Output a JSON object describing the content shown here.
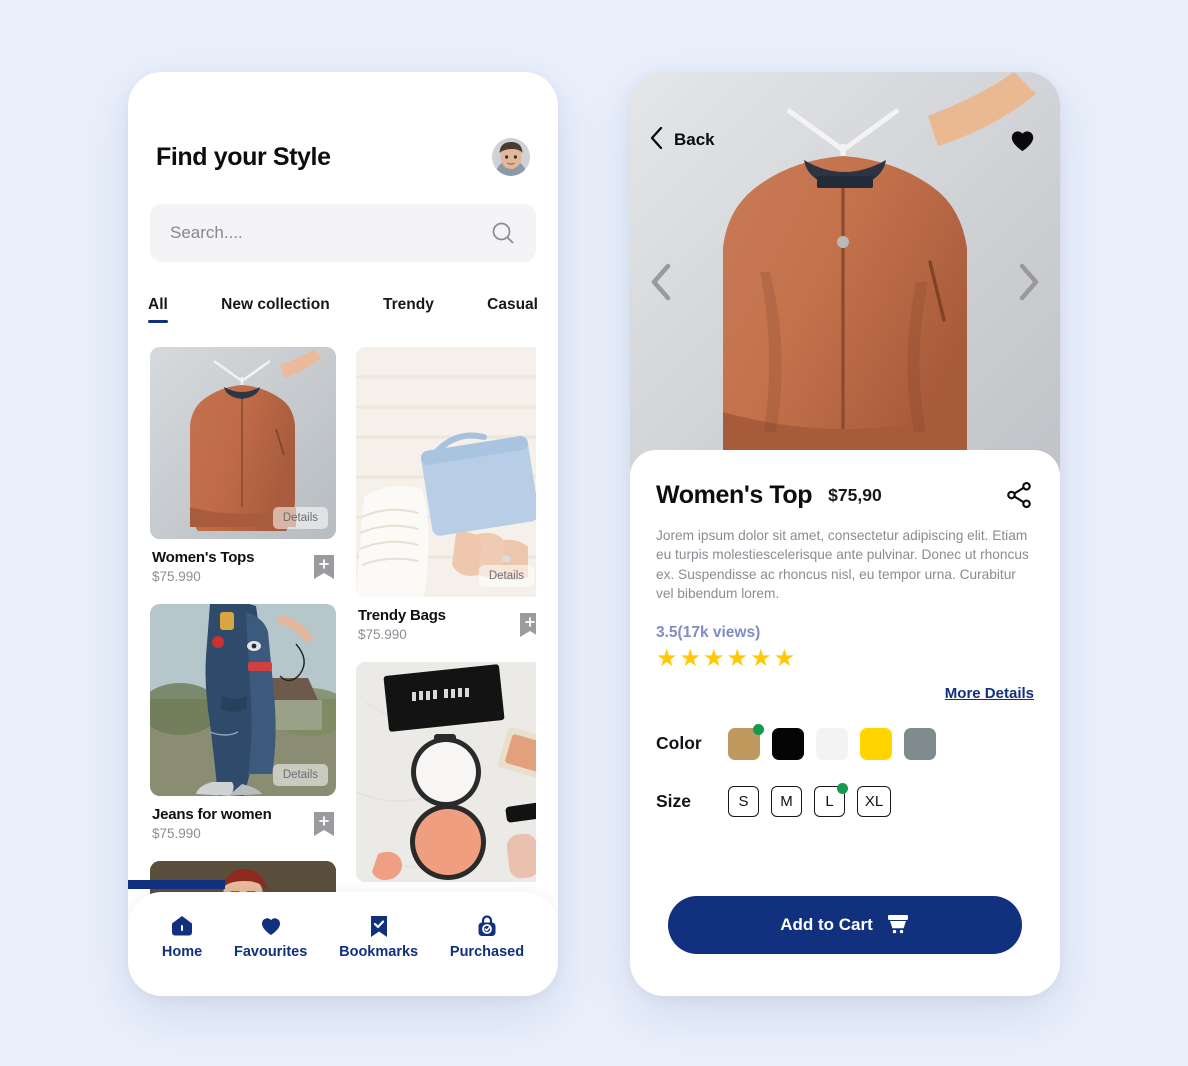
{
  "page": {
    "background_color": "#e9effb"
  },
  "browse_screen": {
    "title": "Find your Style",
    "avatar_name": "user-avatar",
    "search": {
      "placeholder": "Search....",
      "value": "",
      "icon": "search-icon"
    },
    "tabs": [
      {
        "label": "All",
        "active": true
      },
      {
        "label": "New collection",
        "active": false
      },
      {
        "label": "Trendy",
        "active": false
      },
      {
        "label": "Casual",
        "active": false
      }
    ],
    "details_badge_label": "Details",
    "products": [
      {
        "name": "Women's Tops",
        "price": "$75.990",
        "image": "orange-bomber-jacket-on-hanger",
        "column": "left",
        "badge": "Details"
      },
      {
        "name": "Trendy Bags",
        "price": "$75.990",
        "image": "light-blue-handbag-held-in-hand",
        "column": "right",
        "badge": "Details"
      },
      {
        "name": "Jeans for women",
        "price": "$75.990",
        "image": "woman-wearing-ripped-blue-jeans",
        "column": "left",
        "badge": "Details"
      },
      {
        "name": "",
        "price": "",
        "image": "makeup-flatlay-on-marble",
        "column": "right",
        "badge": ""
      },
      {
        "name": "",
        "price": "",
        "image": "smiling-woman-in-red-top",
        "column": "left",
        "badge": ""
      }
    ],
    "bottom_nav": [
      {
        "label": "Home",
        "icon": "home-icon",
        "active": true
      },
      {
        "label": "Favourites",
        "icon": "heart-icon",
        "active": false
      },
      {
        "label": "Bookmarks",
        "icon": "bookmark-check-icon",
        "active": false
      },
      {
        "label": "Purchased",
        "icon": "bag-lock-icon",
        "active": false
      }
    ],
    "accent_color": "#11307e"
  },
  "detail_screen": {
    "back_label": "Back",
    "back_icon": "chevron-left-icon",
    "favourite_icon": "heart-filled-icon",
    "prev_icon": "chevron-left-large-icon",
    "next_icon": "chevron-right-large-icon",
    "hero_image": "orange-bomber-jacket-on-hanger",
    "product_title": "Women's Top",
    "product_price": "$75,90",
    "share_icon": "share-icon",
    "description": "Jorem ipsum dolor sit amet, consectetur adipiscing elit. Etiam eu turpis molestiescelerisque ante pulvinar. Donec ut rhoncus ex. Suspendisse ac rhoncus nisl, eu tempor urna. Curabitur vel bibendum lorem.",
    "rating_text": "3.5(17k views)",
    "stars_filled": 6,
    "star_color": "#ffc90a",
    "rating_text_color": "#7f8cc6",
    "more_details_label": "More Details",
    "color_label": "Color",
    "colors": [
      {
        "name": "tan",
        "hex": "#c0995e",
        "selected": true
      },
      {
        "name": "black",
        "hex": "#050505",
        "selected": false
      },
      {
        "name": "off-white",
        "hex": "#f4f4f4",
        "selected": false
      },
      {
        "name": "yellow",
        "hex": "#ffd400",
        "selected": false
      },
      {
        "name": "slate-gray",
        "hex": "#808b90",
        "selected": false
      }
    ],
    "size_label": "Size",
    "sizes": [
      {
        "label": "S",
        "selected": false
      },
      {
        "label": "M",
        "selected": false
      },
      {
        "label": "L",
        "selected": true
      },
      {
        "label": "XL",
        "selected": false
      }
    ],
    "cart_button_label": "Add to Cart",
    "cart_icon": "shopping-cart-icon",
    "accent_color": "#11307e",
    "selected_dot_color": "#159a4e"
  }
}
